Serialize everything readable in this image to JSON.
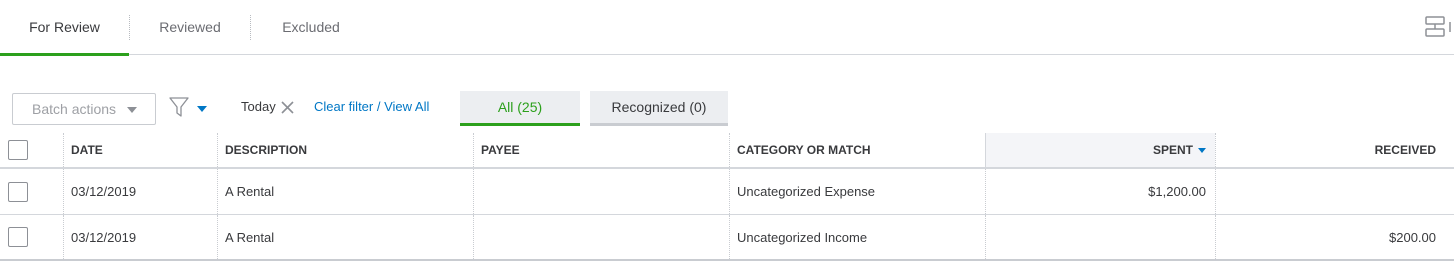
{
  "tabs": [
    {
      "label": "For Review",
      "active": true
    },
    {
      "label": "Reviewed"
    },
    {
      "label": "Excluded"
    }
  ],
  "toolbar": {
    "batch_actions": "Batch actions",
    "filter_chip": "Today",
    "clear_filter": "Clear filter / View All",
    "segments": {
      "all": "All (25)",
      "recognized": "Recognized (0)"
    }
  },
  "table": {
    "columns": [
      "DATE",
      "DESCRIPTION",
      "PAYEE",
      "CATEGORY OR MATCH",
      "SPENT",
      "RECEIVED"
    ],
    "sorted_column": "SPENT",
    "rows": [
      {
        "date": "03/12/2019",
        "description": "A Rental",
        "payee": "",
        "category": "Uncategorized Expense",
        "spent": "$1,200.00",
        "received": ""
      },
      {
        "date": "03/12/2019",
        "description": "A Rental",
        "payee": "",
        "category": "Uncategorized Income",
        "spent": "",
        "received": "$200.00"
      }
    ]
  },
  "colors": {
    "accent_green": "#2ca01c",
    "link_blue": "#0077c5",
    "text": "#393a3d"
  }
}
